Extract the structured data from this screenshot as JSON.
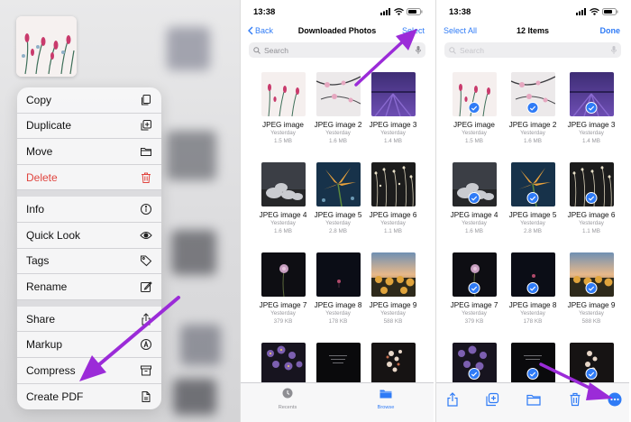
{
  "menu": {
    "items": [
      {
        "label": "Copy",
        "icon": "copy-icon"
      },
      {
        "label": "Duplicate",
        "icon": "duplicate-icon"
      },
      {
        "label": "Move",
        "icon": "folder-icon"
      },
      {
        "label": "Delete",
        "icon": "trash-icon",
        "color": "#e0443e"
      },
      {
        "label": "Info",
        "icon": "info-icon"
      },
      {
        "label": "Quick Look",
        "icon": "eye-icon"
      },
      {
        "label": "Tags",
        "icon": "tag-icon"
      },
      {
        "label": "Rename",
        "icon": "pencil-square-icon"
      },
      {
        "label": "Share",
        "icon": "share-icon"
      },
      {
        "label": "Markup",
        "icon": "markup-icon"
      },
      {
        "label": "Compress",
        "icon": "archive-box-icon"
      },
      {
        "label": "Create PDF",
        "icon": "document-icon"
      }
    ]
  },
  "screen2": {
    "time": "13:38",
    "back_label": "Back",
    "title": "Downloaded Photos",
    "select_label": "Select",
    "search_placeholder": "Search",
    "files": [
      {
        "name": "JPEG image",
        "date": "Yesterday",
        "size": "1.5 MB"
      },
      {
        "name": "JPEG image 2",
        "date": "Yesterday",
        "size": "1.6 MB"
      },
      {
        "name": "JPEG image 3",
        "date": "Yesterday",
        "size": "1.4 MB"
      },
      {
        "name": "JPEG image 4",
        "date": "Yesterday",
        "size": "1.6 MB"
      },
      {
        "name": "JPEG image 5",
        "date": "Yesterday",
        "size": "2.8 MB"
      },
      {
        "name": "JPEG image 6",
        "date": "Yesterday",
        "size": "1.1 MB"
      },
      {
        "name": "JPEG image 7",
        "date": "Yesterday",
        "size": "379 KB"
      },
      {
        "name": "JPEG image 8",
        "date": "Yesterday",
        "size": "178 KB"
      },
      {
        "name": "JPEG image 9",
        "date": "Yesterday",
        "size": "588 KB"
      }
    ],
    "tabs": [
      {
        "label": "Recents",
        "active": false
      },
      {
        "label": "Browse",
        "active": true
      }
    ]
  },
  "screen3": {
    "time": "13:38",
    "select_all_label": "Select All",
    "title": "12 Items",
    "done_label": "Done",
    "search_placeholder": "Search",
    "files": [
      {
        "name": "JPEG image",
        "date": "Yesterday",
        "size": "1.5 MB"
      },
      {
        "name": "JPEG image 2",
        "date": "Yesterday",
        "size": "1.6 MB"
      },
      {
        "name": "JPEG image 3",
        "date": "Yesterday",
        "size": "1.4 MB"
      },
      {
        "name": "JPEG image 4",
        "date": "Yesterday",
        "size": "1.6 MB"
      },
      {
        "name": "JPEG image 5",
        "date": "Yesterday",
        "size": "2.8 MB"
      },
      {
        "name": "JPEG image 6",
        "date": "Yesterday",
        "size": "1.1 MB"
      },
      {
        "name": "JPEG image 7",
        "date": "Yesterday",
        "size": "379 KB"
      },
      {
        "name": "JPEG image 8",
        "date": "Yesterday",
        "size": "178 KB"
      },
      {
        "name": "JPEG image 9",
        "date": "Yesterday",
        "size": "588 KB"
      }
    ],
    "toolbar": [
      "share-icon",
      "duplicate-icon",
      "folder-icon",
      "trash-icon",
      "more-icon"
    ]
  },
  "colors": {
    "accent": "#2f7bf6",
    "danger": "#e0443e",
    "arrow": "#9b2bd8"
  }
}
